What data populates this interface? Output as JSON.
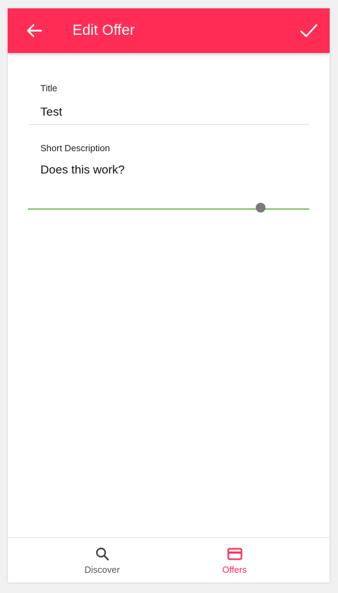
{
  "appbar": {
    "title": "Edit Offer",
    "back_icon": "arrow-left-icon",
    "confirm_icon": "check-icon",
    "color": "#ff2d55"
  },
  "form": {
    "title_field": {
      "label": "Title",
      "value": "Test"
    },
    "description_field": {
      "label": "Short Description",
      "value": "Does this work?",
      "focus_color": "#7cc26b"
    }
  },
  "bottom_nav": {
    "items": [
      {
        "label": "Discover",
        "icon": "search-icon",
        "active": false,
        "color": "#555555"
      },
      {
        "label": "Offers",
        "icon": "credit-card-icon",
        "active": true,
        "color": "#ff2d55"
      }
    ]
  }
}
